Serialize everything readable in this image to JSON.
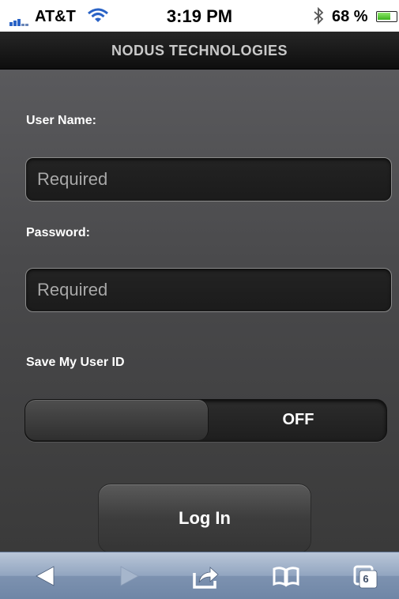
{
  "status_bar": {
    "carrier": "AT&T",
    "time": "3:19 PM",
    "battery_percent": "68 %",
    "battery_level": 0.68,
    "icons": [
      "signal-icon",
      "wifi-icon",
      "bluetooth-icon",
      "battery-icon"
    ]
  },
  "header": {
    "title": "NODUS TECHNOLOGIES"
  },
  "form": {
    "username_label": "User Name:",
    "username_placeholder": "Required",
    "password_label": "Password:",
    "password_placeholder": "Required",
    "save_user_id_label": "Save My User ID",
    "save_user_id_state": "OFF",
    "login_label": "Log In"
  },
  "toolbar": {
    "icons": [
      "back-icon",
      "forward-icon",
      "share-icon",
      "bookmarks-icon",
      "tabs-icon"
    ],
    "tabs_count": "6"
  },
  "colors": {
    "toolbar_blue": "#8fa3bf",
    "signal_blue": "#2a63c6",
    "battery_green": "#4cc224"
  }
}
